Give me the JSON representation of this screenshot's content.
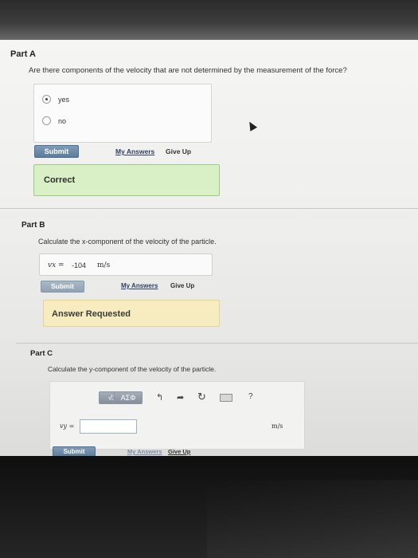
{
  "partA": {
    "title": "Part A",
    "question": "Are there components of the velocity that are not determined by the measurement of the force?",
    "options": [
      {
        "label": "yes",
        "selected": true
      },
      {
        "label": "no",
        "selected": false
      }
    ],
    "submit_label": "Submit",
    "my_answers_label": "My Answers",
    "give_up_label": "Give Up",
    "feedback": "Correct"
  },
  "partB": {
    "title": "Part B",
    "question": "Calculate the x-component of the velocity of the particle.",
    "variable": "vx =",
    "value": "-104",
    "unit": "m/s",
    "submit_label": "Submit",
    "my_answers_label": "My Answers",
    "give_up_label": "Give Up",
    "feedback": "Answer Requested"
  },
  "partC": {
    "title": "Part C",
    "question": "Calculate the y-component of the velocity of the particle.",
    "toolbar": {
      "templates_label": "√□",
      "greek_label": "ΑΣΦ",
      "help_label": "?"
    },
    "variable": "vy =",
    "input_value": "",
    "unit": "m/s",
    "submit_label": "Submit",
    "my_answers_label": "My Answers",
    "give_up_label": "Give Up"
  },
  "colors": {
    "correct_bg": "#d9f0c6",
    "requested_bg": "#f6ecbf",
    "submit_button": "#5c7c9c"
  }
}
